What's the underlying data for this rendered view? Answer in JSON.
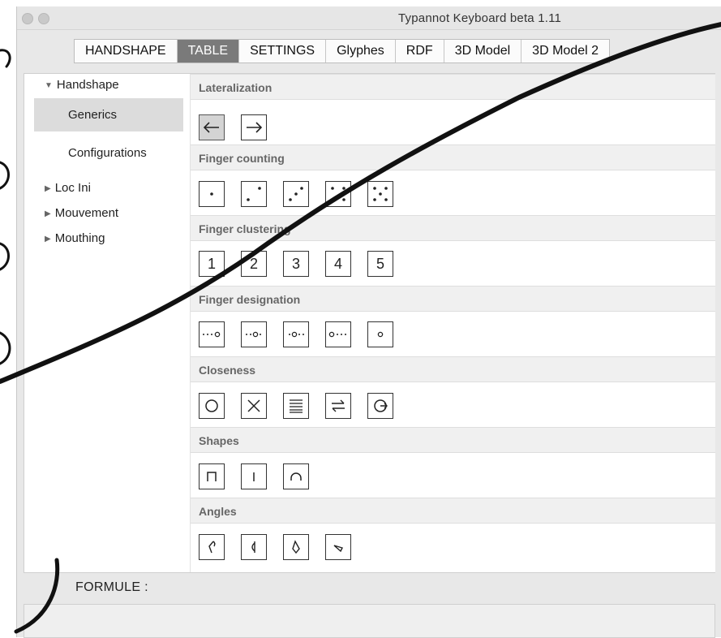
{
  "window": {
    "title": "Typannot Keyboard beta 1.11"
  },
  "tabs": [
    {
      "label": "HANDSHAPE",
      "active": false
    },
    {
      "label": "TABLE",
      "active": true
    },
    {
      "label": "SETTINGS",
      "active": false
    },
    {
      "label": "Glyphes",
      "active": false
    },
    {
      "label": "RDF",
      "active": false
    },
    {
      "label": "3D Model",
      "active": false
    },
    {
      "label": "3D Model 2",
      "active": false
    }
  ],
  "sidebar": {
    "handshape": {
      "label": "Handshape",
      "expanded": true
    },
    "generics": {
      "label": "Generics",
      "selected": true
    },
    "configurations": {
      "label": "Configurations"
    },
    "loc_ini": {
      "label": "Loc Ini",
      "expanded": false
    },
    "mouvement": {
      "label": "Mouvement",
      "expanded": false
    },
    "mouthing": {
      "label": "Mouthing",
      "expanded": false
    }
  },
  "sections": {
    "lateralization": {
      "title": "Lateralization",
      "keys": [
        "left-arrow",
        "right-arrow"
      ],
      "selected": "left-arrow"
    },
    "finger_counting": {
      "title": "Finger counting",
      "keys": [
        "dice-1",
        "dice-2",
        "dice-3",
        "dice-4",
        "dice-5"
      ]
    },
    "finger_clustering": {
      "title": "Finger clustering",
      "keys": [
        "1",
        "2",
        "3",
        "4",
        "5"
      ]
    },
    "finger_designation": {
      "title": "Finger designation",
      "keys": [
        "designation-4",
        "designation-3",
        "designation-2",
        "designation-1",
        "designation-0"
      ]
    },
    "closeness": {
      "title": "Closeness",
      "keys": [
        "circle",
        "cross",
        "lines",
        "exchange-arrows",
        "circle-arrow"
      ]
    },
    "shapes": {
      "title": "Shapes",
      "keys": [
        "shape-square",
        "shape-line",
        "shape-arc"
      ]
    },
    "angles": {
      "title": "Angles",
      "keys": [
        "angle-1",
        "angle-2",
        "angle-3",
        "angle-4"
      ]
    }
  },
  "formula": {
    "label": "FORMULE :",
    "value": ""
  },
  "colors": {
    "active_tab": "#7a7a7a",
    "section_header": "#f0f0f0",
    "selected": "#dcdcdc",
    "pen": "#111111"
  }
}
